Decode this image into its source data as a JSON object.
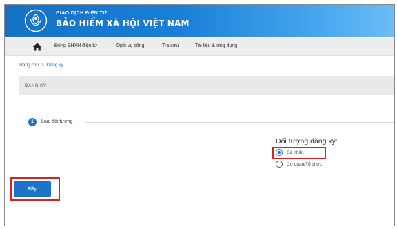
{
  "header": {
    "top_line": "GIAO DỊCH ĐIỆN TỬ",
    "main_line": "BẢO HIỂM XÃ HỘI VIỆT NAM",
    "brand_color": "#1a7fd6",
    "logo_icon": "vss-emblem-icon"
  },
  "nav": {
    "home_icon": "home-icon",
    "items": [
      {
        "label": "Đóng BHXH điện tử"
      },
      {
        "label": "Dịch vụ công"
      },
      {
        "label": "Tra cứu"
      },
      {
        "label": "Tài liệu & ứng dụng"
      }
    ]
  },
  "breadcrumb": {
    "home": "Trang chủ",
    "separator": ">",
    "current": "Đăng ký"
  },
  "page": {
    "title": "ĐĂNG KÝ"
  },
  "step": {
    "number": "1",
    "label": "Loại đối tượng"
  },
  "registration_type": {
    "title": "Đối tượng đăng ký:",
    "options": [
      {
        "label": "Cá nhân",
        "selected": true
      },
      {
        "label": "Cơ quan/Tổ chức",
        "selected": false
      }
    ]
  },
  "actions": {
    "next_label": "Tiếp"
  },
  "highlight_color": "#e0201f",
  "accent_color": "#1a73c8"
}
